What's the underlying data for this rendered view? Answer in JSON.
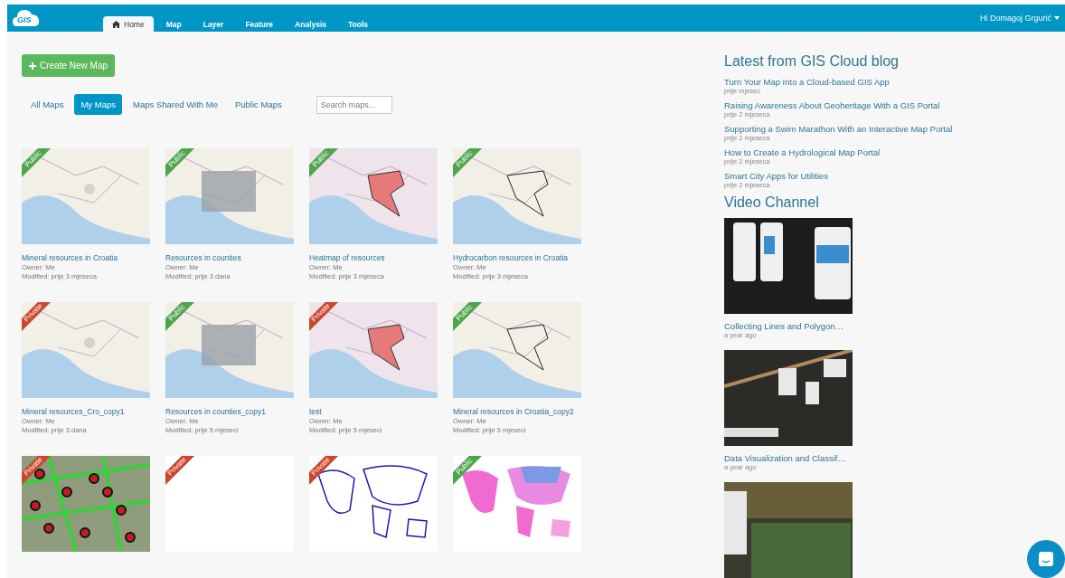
{
  "navbar": {
    "logo": "GIS",
    "tabs": [
      {
        "label": "Home",
        "selected": true
      },
      {
        "label": "Map",
        "selected": false
      },
      {
        "label": "Layer",
        "selected": false
      },
      {
        "label": "Feature",
        "selected": false
      },
      {
        "label": "Analysis",
        "selected": false
      },
      {
        "label": "Tools",
        "selected": false
      }
    ],
    "user": "Hi Domagoj Grgurić"
  },
  "create_button": "Create New Map",
  "filters": [
    {
      "label": "All Maps",
      "selected": false
    },
    {
      "label": "My Maps",
      "selected": true
    },
    {
      "label": "Maps Shared With Me",
      "selected": false
    },
    {
      "label": "Public Maps",
      "selected": false
    }
  ],
  "search": {
    "placeholder": "Search maps..."
  },
  "maps": [
    {
      "title": "Mineral resources in Croatia",
      "owner": "Owner: Me",
      "modified": "Modified: prije 3 mjeseca",
      "badge": "Public",
      "public": true,
      "kind": "picture"
    },
    {
      "title": "Resources in counties",
      "owner": "Owner: Me",
      "modified": "Modified: prije 3 dana",
      "badge": "Public",
      "public": true,
      "kind": "picture"
    },
    {
      "title": "Heatmap of resources",
      "owner": "Owner: Me",
      "modified": "Modified: prije 3 mjeseca",
      "badge": "Public",
      "public": true,
      "kind": "picture"
    },
    {
      "title": "Hydrocarbon resources in Croatia",
      "owner": "Owner: Me",
      "modified": "Modified: prije 3 mjeseca",
      "badge": "Public",
      "public": true,
      "kind": "picture"
    },
    {
      "title": "Mineral resources_Cro_copy1",
      "owner": "Owner: Me",
      "modified": "Modified: prije 3 dana",
      "badge": "Private",
      "public": false,
      "kind": "picture"
    },
    {
      "title": "Resources in counties_copy1",
      "owner": "Owner: Me",
      "modified": "Modified: prije 5 mjeseci",
      "badge": "Public",
      "public": true,
      "kind": "picture"
    },
    {
      "title": "test",
      "owner": "Owner: Me",
      "modified": "Modified: prije 5 mjeseci",
      "badge": "Private",
      "public": false,
      "kind": "picture"
    },
    {
      "title": "Mineral resources in Croatia_copy2",
      "owner": "Owner: Me",
      "modified": "Modified: prije 5 mjeseci",
      "badge": "Public",
      "public": true,
      "kind": "picture"
    },
    {
      "badge": "Private",
      "public": false,
      "kind": "picture"
    },
    {
      "badge": "Private",
      "public": false,
      "kind": "blank"
    },
    {
      "badge": "Private",
      "public": false,
      "kind": "picture"
    },
    {
      "badge": "Public",
      "public": true,
      "kind": "picture"
    }
  ],
  "blog": {
    "title": "Latest from GIS Cloud blog",
    "posts": [
      {
        "title": "Turn Your Map Into a Cloud-based GIS App",
        "date": "prije mjesec"
      },
      {
        "title": "Raising Awareness About Geoheritage With a GIS Portal",
        "date": "prije 2 mjeseca"
      },
      {
        "title": "Supporting a Swim Marathon With an Interactive Map Portal",
        "date": "prije 2 mjeseca"
      },
      {
        "title": "How to Create a Hydrological Map Portal",
        "date": "prije 2 mjeseca"
      },
      {
        "title": "Smart City Apps for Utilities",
        "date": "prije 2 mjeseca"
      }
    ]
  },
  "videos": {
    "title": "Video Channel",
    "items": [
      {
        "title": "Collecting Lines and Polygon…",
        "date": "a year ago",
        "kind": "picture"
      },
      {
        "title": "Data Visualization and Classif…",
        "date": "a year ago",
        "kind": "picture"
      },
      {
        "kind": "picture"
      }
    ]
  }
}
